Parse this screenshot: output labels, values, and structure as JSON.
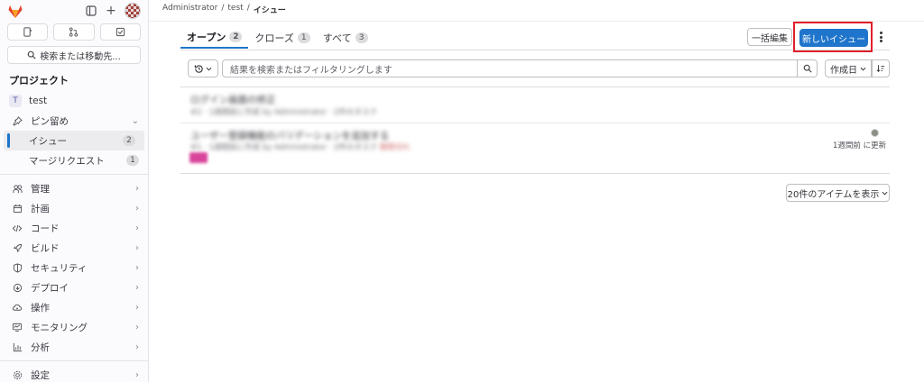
{
  "sidebar": {
    "search_label": "検索または移動先...",
    "section_title": "プロジェクト",
    "project": {
      "initial": "T",
      "name": "test"
    },
    "items": [
      {
        "label": "ピン留め",
        "icon": "pin-icon",
        "chevron": "⌄"
      },
      {
        "label": "イシュー",
        "badge": "2",
        "active": true
      },
      {
        "label": "マージリクエスト",
        "badge": "1"
      },
      {
        "label": "管理",
        "icon": "users-icon"
      },
      {
        "label": "計画",
        "icon": "calendar-icon"
      },
      {
        "label": "コード",
        "icon": "code-icon"
      },
      {
        "label": "ビルド",
        "icon": "rocket-icon"
      },
      {
        "label": "セキュリティ",
        "icon": "shield-icon"
      },
      {
        "label": "デプロイ",
        "icon": "deploy-icon"
      },
      {
        "label": "操作",
        "icon": "cloud-icon"
      },
      {
        "label": "モニタリング",
        "icon": "monitor-icon"
      },
      {
        "label": "分析",
        "icon": "chart-icon"
      },
      {
        "label": "設定",
        "icon": "gear-icon"
      }
    ]
  },
  "breadcrumb": {
    "root": "Administrator",
    "sep": "/",
    "project": "test",
    "current": "イシュー"
  },
  "tabs": [
    {
      "label": "オープン",
      "count": "2",
      "active": true
    },
    {
      "label": "クローズ",
      "count": "1"
    },
    {
      "label": "すべて",
      "count": "3"
    }
  ],
  "actions": {
    "bulk_edit": "一括編集",
    "new_issue": "新しいイシュー"
  },
  "filter": {
    "placeholder": "結果を検索またはフィルタリングします",
    "sort_label": "作成日"
  },
  "issues": [
    {
      "title": "ログイン画面の修正",
      "meta": "#2 · 1週間前に作成 by Administrator · 2件のタスク"
    },
    {
      "title": "ユーザー登録機能のバリデーションを追加する",
      "meta": "#1 · 1週間前に作成 by Administrator · 2件のタスク",
      "meta_red": "期限切れ",
      "updated": "1週間前 に更新"
    }
  ],
  "pagination": {
    "show_label": "20件のアイテムを表示"
  },
  "colors": {
    "primary": "#1f75cb",
    "highlight": "#e0202b"
  }
}
